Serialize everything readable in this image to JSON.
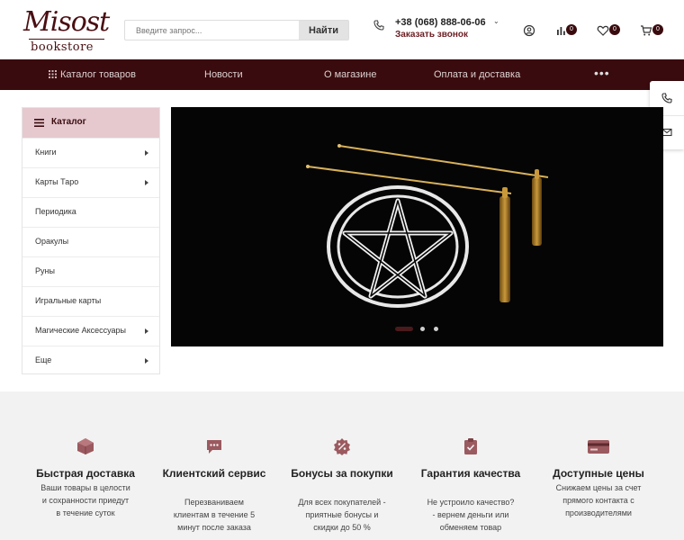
{
  "header": {
    "logo_script": "Misost",
    "logo_sub": "bookstore",
    "search": {
      "placeholder": "Введите запрос...",
      "button_label": "Найти"
    },
    "phone": {
      "number": "+38 (068) 888-06-06",
      "callback_label": "Заказать звонок"
    },
    "badges": {
      "compare": "0",
      "favorites": "0",
      "cart": "0"
    }
  },
  "nav": {
    "items": [
      {
        "label": "Каталог товаров"
      },
      {
        "label": "Новости"
      },
      {
        "label": "О магазине"
      },
      {
        "label": "Оплата и доставка"
      }
    ],
    "more": "•••"
  },
  "catalog": {
    "title": "Каталог",
    "items": [
      {
        "label": "Книги",
        "has_submenu": true
      },
      {
        "label": "Карты Таро",
        "has_submenu": true
      },
      {
        "label": "Периодика",
        "has_submenu": false
      },
      {
        "label": "Оракулы",
        "has_submenu": false
      },
      {
        "label": "Руны",
        "has_submenu": false
      },
      {
        "label": "Игральные карты",
        "has_submenu": false
      },
      {
        "label": "Магические Аксессуары",
        "has_submenu": true
      },
      {
        "label": "Еще",
        "has_submenu": true
      }
    ]
  },
  "banner": {
    "slides": 3,
    "active_slide": 1
  },
  "features": [
    {
      "icon": "box-icon",
      "title": "Быстрая доставка",
      "desc": [
        "Ваши товары в целости",
        "и сохранности приедут",
        "в течение суток"
      ]
    },
    {
      "icon": "chat-icon",
      "title": "Клиентский сервис",
      "desc": [
        "Перезваниваем",
        "клиентам в течение 5",
        "минут после заказа"
      ]
    },
    {
      "icon": "discount-icon",
      "title": "Бонусы за покупки",
      "desc": [
        "Для всех покупателей -",
        "приятные бонусы и",
        "скидки до 50 %"
      ]
    },
    {
      "icon": "clipboard-check-icon",
      "title": "Гарантия качества",
      "desc": [
        "Не устроило качество?",
        "- вернем деньги или",
        "обменяем товар"
      ]
    },
    {
      "icon": "credit-card-icon",
      "title": "Доступные цены",
      "desc": [
        "Снижаем цены за счет",
        "прямого контакта с",
        "производителями"
      ]
    }
  ],
  "colors": {
    "brand": "#3a0b0e",
    "accent": "#6b1d22",
    "catalog_head": "#e5c9cf",
    "icon": "#9b5a5f"
  }
}
